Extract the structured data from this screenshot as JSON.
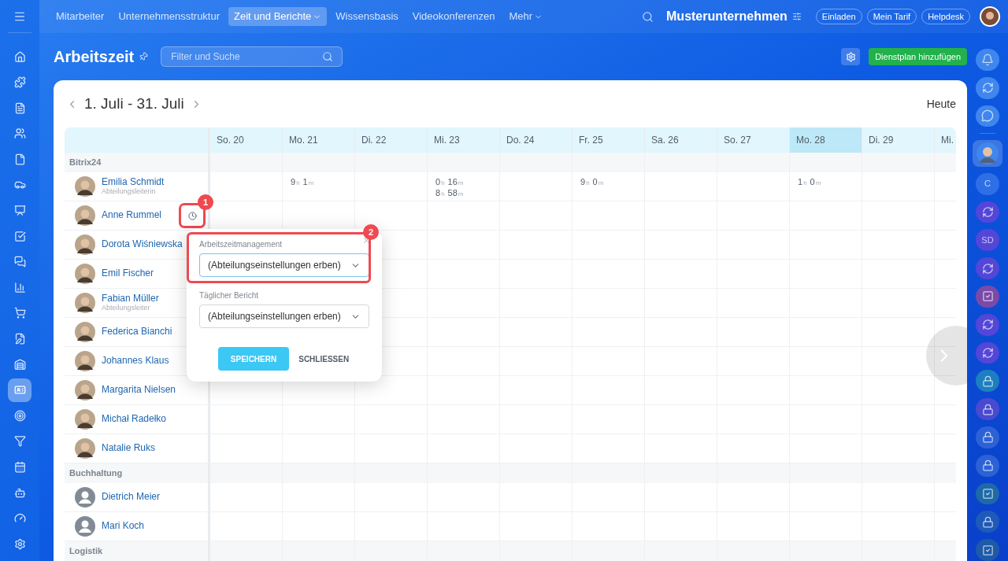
{
  "top_nav": {
    "items": [
      {
        "label": "Mitarbeiter",
        "selected": false,
        "has_menu": false
      },
      {
        "label": "Unternehmensstruktur",
        "selected": false,
        "has_menu": false
      },
      {
        "label": "Zeit und Berichte",
        "selected": true,
        "has_menu": true
      },
      {
        "label": "Wissensbasis",
        "selected": false,
        "has_menu": false
      },
      {
        "label": "Videokonferenzen",
        "selected": false,
        "has_menu": false
      },
      {
        "label": "Mehr",
        "selected": false,
        "has_menu": true
      }
    ],
    "company": "Musterunternehmen",
    "buttons": [
      "Einladen",
      "Mein Tarif",
      "Helpdesk"
    ]
  },
  "left_nav": [
    {
      "selected": false
    },
    {
      "selected": false
    },
    {
      "selected": false
    },
    {
      "selected": false
    },
    {
      "selected": false
    },
    {
      "selected": false
    },
    {
      "selected": false
    },
    {
      "selected": false
    },
    {
      "selected": false
    },
    {
      "selected": false
    },
    {
      "selected": false
    },
    {
      "selected": false
    },
    {
      "selected": false
    },
    {
      "selected": true
    },
    {
      "selected": false
    },
    {
      "selected": false
    },
    {
      "selected": false
    },
    {
      "selected": false
    },
    {
      "selected": false
    },
    {
      "selected": false
    }
  ],
  "header": {
    "title": "Arbeitszeit",
    "search": {
      "placeholder": "Filter und Suche"
    },
    "add_button": "Dienstplan hinzufügen"
  },
  "calendar": {
    "period": "1. Juli - 31. Juli",
    "today_button": "Heute",
    "days": [
      {
        "label": "So. 20",
        "today": false
      },
      {
        "label": "Mo. 21",
        "today": false
      },
      {
        "label": "Di. 22",
        "today": false
      },
      {
        "label": "Mi. 23",
        "today": false
      },
      {
        "label": "Do. 24",
        "today": false
      },
      {
        "label": "Fr. 25",
        "today": false
      },
      {
        "label": "Sa. 26",
        "today": false
      },
      {
        "label": "So. 27",
        "today": false
      },
      {
        "label": "Mo. 28",
        "today": true
      },
      {
        "label": "Di. 29",
        "today": false
      },
      {
        "label": "Mi.",
        "today": false
      }
    ],
    "rows": [
      {
        "kind": "group",
        "name": "Bitrix24"
      },
      {
        "kind": "person",
        "name": "Emilia Schmidt",
        "role": "Abteilungsleiterin",
        "has_photo": true,
        "cells": [
          null,
          [
            [
              "9",
              "h",
              "1",
              "m"
            ]
          ],
          null,
          [
            [
              "0",
              "h",
              "16",
              "m"
            ],
            [
              "8",
              "h",
              "58",
              "m"
            ]
          ],
          null,
          [
            [
              "9",
              "h",
              "0",
              "m"
            ]
          ],
          null,
          null,
          [
            [
              "1",
              "h",
              "0",
              "m"
            ]
          ],
          null,
          null
        ]
      },
      {
        "kind": "person",
        "name": "Anne Rummel",
        "has_photo": true,
        "settings_icon": true
      },
      {
        "kind": "person",
        "name": "Dorota Wiśniewska",
        "has_photo": true
      },
      {
        "kind": "person",
        "name": "Emil Fischer",
        "has_photo": true
      },
      {
        "kind": "person",
        "name": "Fabian Müller",
        "role": "Abteilungsleiter",
        "has_photo": true
      },
      {
        "kind": "person",
        "name": "Federica Bianchi",
        "has_photo": true
      },
      {
        "kind": "person",
        "name": "Johannes Klaus",
        "has_photo": true
      },
      {
        "kind": "person",
        "name": "Margarita Nielsen",
        "has_photo": true
      },
      {
        "kind": "person",
        "name": "Michał Radełko",
        "has_photo": true
      },
      {
        "kind": "person",
        "name": "Natalie Ruks",
        "has_photo": true
      },
      {
        "kind": "group",
        "name": "Buchhaltung"
      },
      {
        "kind": "person",
        "name": "Dietrich Meier",
        "has_photo": false
      },
      {
        "kind": "person",
        "name": "Mari Koch",
        "has_photo": false
      },
      {
        "kind": "group",
        "name": "Logistik"
      }
    ]
  },
  "popup": {
    "fields": [
      {
        "label": "Arbeitszeitmanagement",
        "value": "(Abteilungseinstellungen erben)"
      },
      {
        "label": "Täglicher Bericht",
        "value": "(Abteilungseinstellungen erben)"
      }
    ],
    "save_button": "SPEICHERN",
    "close_button": "SCHLIESSEN"
  },
  "annotations": [
    "1",
    "2"
  ],
  "right_bar": [
    {
      "kind": "bell",
      "color": "#3f86ee"
    },
    {
      "kind": "sync",
      "color": "#3f86ee"
    },
    {
      "kind": "chat",
      "color": "#3f86ee"
    },
    {
      "kind": "avatar",
      "color": "#3f86ee"
    },
    {
      "kind": "initials",
      "text": "C",
      "color": "#2f6fe6"
    },
    {
      "kind": "sync",
      "color": "#5346d8"
    },
    {
      "kind": "initials",
      "text": "SD",
      "color": "#5346d8"
    },
    {
      "kind": "sync",
      "color": "#5346d8"
    },
    {
      "kind": "check",
      "color": "#7a4aa8"
    },
    {
      "kind": "sync",
      "color": "#5346d8"
    },
    {
      "kind": "sync",
      "color": "#5346d8"
    },
    {
      "kind": "lock",
      "color": "#1c7fbf"
    },
    {
      "kind": "lock",
      "color": "#4a4ad0"
    },
    {
      "kind": "lock",
      "color": "#2c62d6"
    },
    {
      "kind": "lock",
      "color": "#2c62d6"
    },
    {
      "kind": "check",
      "color": "#1e6aa8"
    },
    {
      "kind": "lock",
      "color": "#1e5ab8"
    },
    {
      "kind": "check",
      "color": "#1e5aa8"
    }
  ]
}
